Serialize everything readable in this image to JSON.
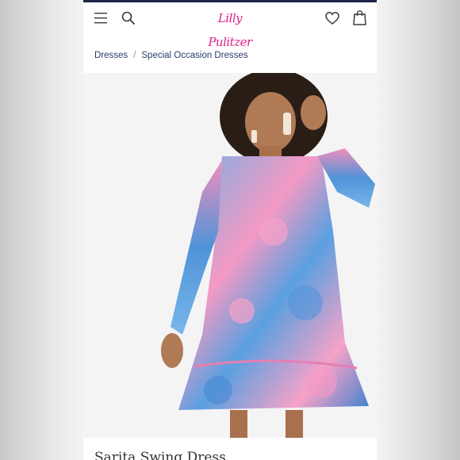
{
  "header": {
    "logo_text": "Lilly Pulitzer",
    "icons": [
      "menu-icon",
      "search-icon",
      "heart-icon",
      "bag-icon"
    ],
    "accent_color": "#e0218a",
    "top_bar_color": "#1c2347"
  },
  "breadcrumb": {
    "items": [
      {
        "label": "Dresses"
      },
      {
        "label": "Special Occasion Dresses"
      }
    ],
    "separator": "/"
  },
  "product": {
    "title": "Sarita Swing Dress"
  }
}
